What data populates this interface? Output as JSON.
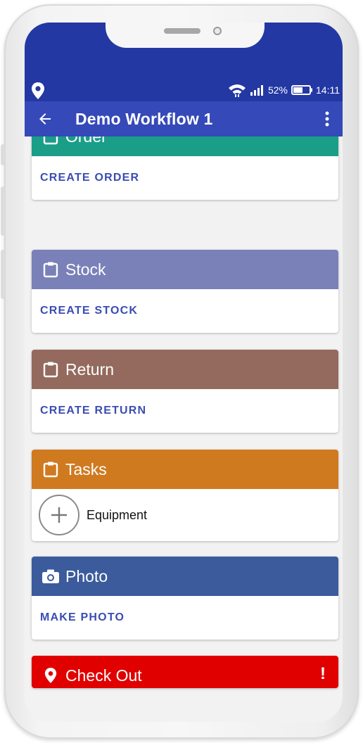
{
  "status_bar": {
    "battery_percent": "52%",
    "time": "14:11",
    "location_icon": "location-pin-icon",
    "wifi_icon": "wifi-icon",
    "signal_icon": "signal-icon",
    "battery_icon": "battery-icon"
  },
  "app_bar": {
    "title": "Demo Workflow 1",
    "back_icon": "arrow-back-icon",
    "menu_icon": "more-vert-icon"
  },
  "cards": {
    "order": {
      "title": "Order",
      "icon": "clipboard-icon",
      "action": "CREATE ORDER",
      "color": "#1a9e88"
    },
    "stock": {
      "title": "Stock",
      "icon": "clipboard-icon",
      "action": "CREATE STOCK",
      "color": "#7a80b8"
    },
    "return": {
      "title": "Return",
      "icon": "clipboard-icon",
      "action": "CREATE RETURN",
      "color": "#936a5d"
    },
    "tasks": {
      "title": "Tasks",
      "icon": "clipboard-icon",
      "item": "Equipment",
      "item_icon": "add-icon",
      "color": "#d07a20"
    },
    "photo": {
      "title": "Photo",
      "icon": "camera-icon",
      "action": "MAKE PHOTO",
      "color": "#3b5b9c"
    },
    "checkout": {
      "title": "Check Out",
      "icon": "location-pin-icon",
      "alert": "!",
      "color": "#e00000"
    }
  },
  "colors": {
    "status_bar": "#2338a3",
    "app_bar": "#3549b9",
    "link": "#3a4cb3"
  }
}
